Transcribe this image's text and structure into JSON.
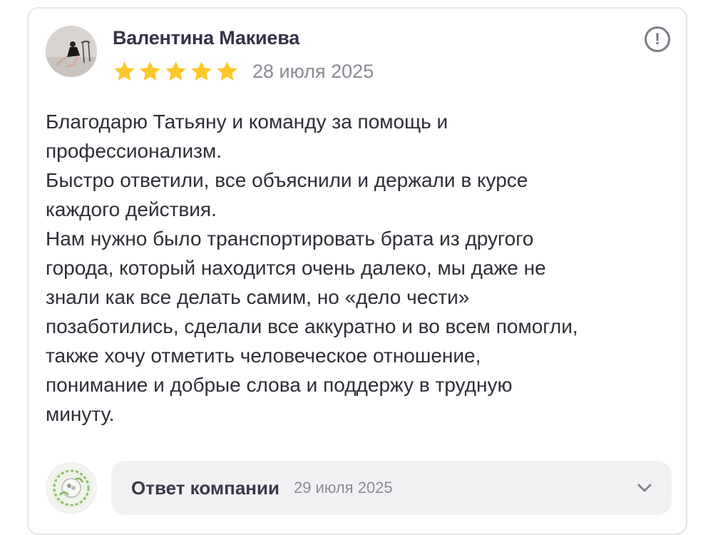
{
  "review": {
    "author": "Валентина Макиева",
    "rating": 5,
    "rating_max": 5,
    "date": "28 июля 2025",
    "text": "Благодарю Татьяну и команду за помощь и\nпрофессионализм.\nБыстро ответили, все объяснили и держали в курсе\nкаждого действия.\nНам нужно было транспортировать брата из другого\nгорода, который находится очень далеко, мы даже не\nзнали как все делать самим, но «дело чести»\nпозаботились, сделали все аккуратно и во всем помогли,\nтакже хочу отметить человеческое отношение,\nпонимание и добрые слова и поддержу в трудную\nминуту."
  },
  "company_reply": {
    "label": "Ответ компании",
    "date": "29 июля 2025",
    "expanded": false
  },
  "icons": {
    "info": "exclamation-circle-icon",
    "star": "star-icon",
    "expand": "chevron-down-icon"
  },
  "colors": {
    "star": "#ffc72c",
    "reply_bg": "#f1f1f4",
    "card_border": "#e6e6ea"
  }
}
